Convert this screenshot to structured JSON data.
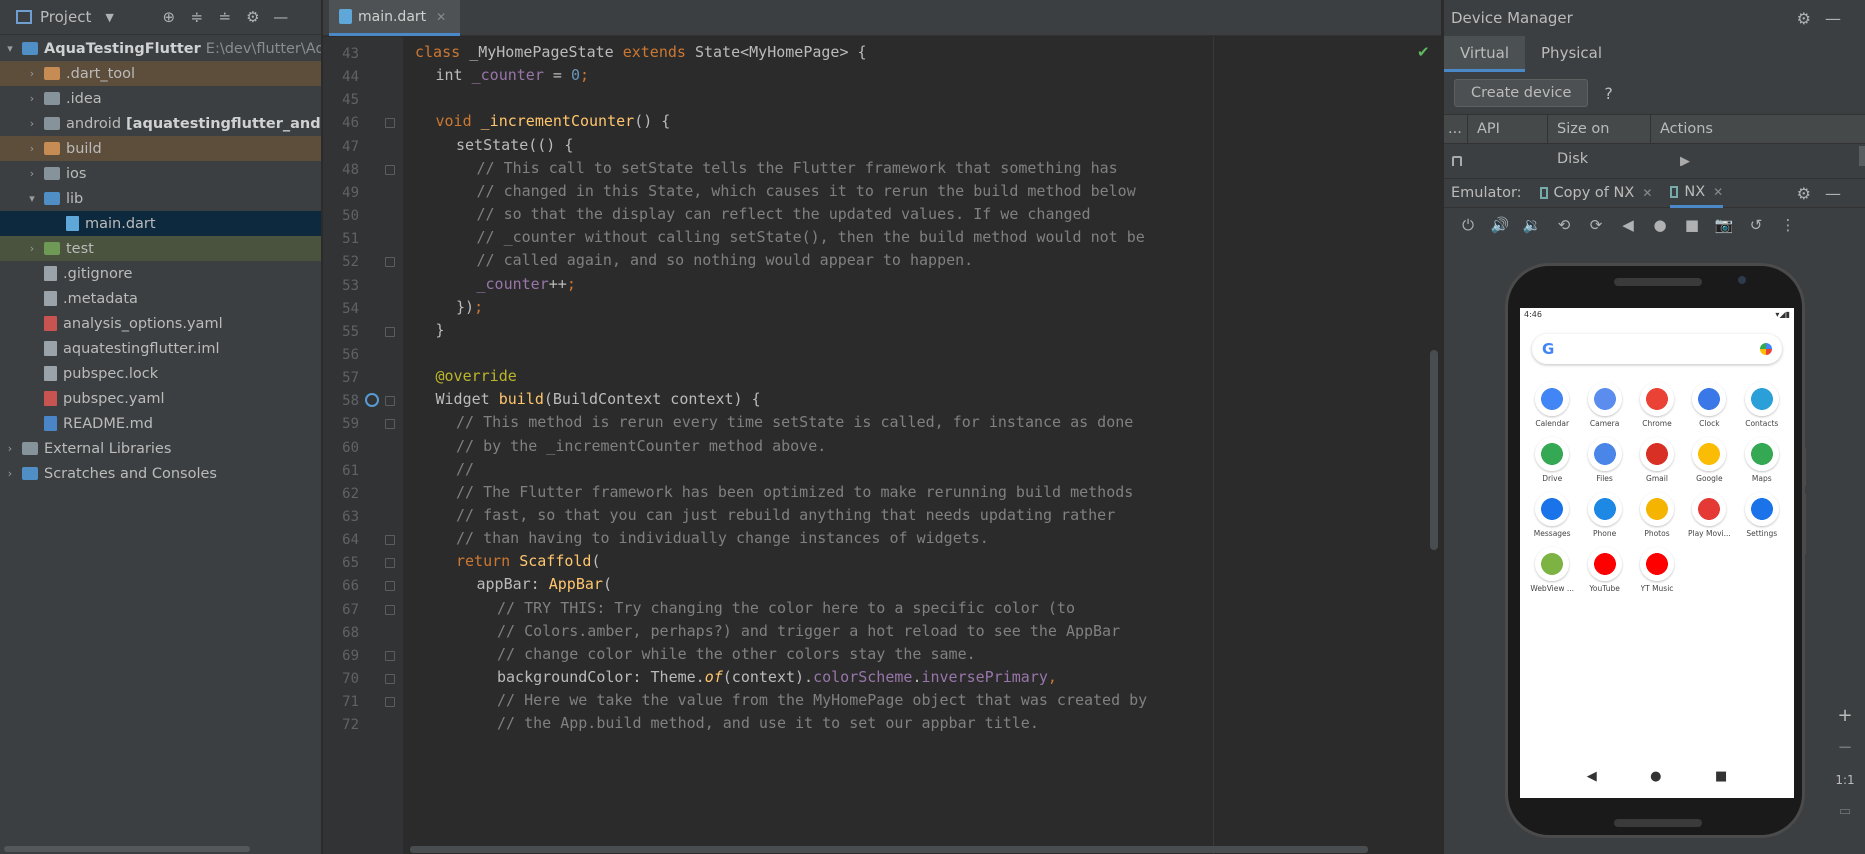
{
  "project": {
    "title": "Project",
    "tree": [
      {
        "label": "AquaTestingFlutter",
        "extra": "E:\\dev\\flutter\\Aqua",
        "indent": 0,
        "arrow": "▾",
        "icon": "flutter",
        "bold": true
      },
      {
        "label": ".dart_tool",
        "indent": 1,
        "arrow": "›",
        "icon": "folder-orange",
        "state": "excluded"
      },
      {
        "label": ".idea",
        "indent": 1,
        "arrow": "›",
        "icon": "folder"
      },
      {
        "label": "android",
        "extra": "[aquatestingflutter_android]",
        "indent": 1,
        "arrow": "›",
        "icon": "folder"
      },
      {
        "label": "build",
        "indent": 1,
        "arrow": "›",
        "icon": "folder-orange",
        "state": "excluded"
      },
      {
        "label": "ios",
        "indent": 1,
        "arrow": "›",
        "icon": "folder"
      },
      {
        "label": "lib",
        "indent": 1,
        "arrow": "▾",
        "icon": "folder-blue"
      },
      {
        "label": "main.dart",
        "indent": 2,
        "arrow": "",
        "icon": "dart",
        "state": "selected"
      },
      {
        "label": "test",
        "indent": 1,
        "arrow": "›",
        "icon": "folder-green",
        "state": "testsrc"
      },
      {
        "label": ".gitignore",
        "indent": 1,
        "arrow": "",
        "icon": "file"
      },
      {
        "label": ".metadata",
        "indent": 1,
        "arrow": "",
        "icon": "file"
      },
      {
        "label": "analysis_options.yaml",
        "indent": 1,
        "arrow": "",
        "icon": "yml"
      },
      {
        "label": "aquatestingflutter.iml",
        "indent": 1,
        "arrow": "",
        "icon": "file"
      },
      {
        "label": "pubspec.lock",
        "indent": 1,
        "arrow": "",
        "icon": "file"
      },
      {
        "label": "pubspec.yaml",
        "indent": 1,
        "arrow": "",
        "icon": "yml"
      },
      {
        "label": "README.md",
        "indent": 1,
        "arrow": "",
        "icon": "md"
      },
      {
        "label": "External Libraries",
        "indent": 0,
        "arrow": "›",
        "icon": "lib"
      },
      {
        "label": "Scratches and Consoles",
        "indent": 0,
        "arrow": "›",
        "icon": "scratch"
      }
    ]
  },
  "editor": {
    "tab": "main.dart",
    "lines": [
      {
        "n": "43",
        "indent": 0,
        "tokens": [
          [
            "kw",
            "class "
          ],
          [
            "",
            "_MyHomePageState "
          ],
          [
            "kw",
            "extends "
          ],
          [
            "",
            "State<MyHomePage> {"
          ]
        ]
      },
      {
        "n": "44",
        "indent": 1,
        "tokens": [
          [
            "",
            "int "
          ],
          [
            "fld",
            "_counter"
          ],
          [
            "",
            " = "
          ],
          [
            "num",
            "0"
          ],
          [
            "kw",
            ";"
          ]
        ]
      },
      {
        "n": "45",
        "indent": 0,
        "tokens": []
      },
      {
        "n": "46",
        "indent": 1,
        "tokens": [
          [
            "kw",
            "void "
          ],
          [
            "fn",
            "_incrementCounter"
          ],
          [
            "",
            "() {"
          ]
        ]
      },
      {
        "n": "47",
        "indent": 2,
        "tokens": [
          [
            "",
            "setState(() {"
          ]
        ]
      },
      {
        "n": "48",
        "indent": 3,
        "tokens": [
          [
            "cm",
            "// This call to setState tells the Flutter framework that something has"
          ]
        ]
      },
      {
        "n": "49",
        "indent": 3,
        "tokens": [
          [
            "cm",
            "// changed in this State, which causes it to rerun the build method below"
          ]
        ]
      },
      {
        "n": "50",
        "indent": 3,
        "tokens": [
          [
            "cm",
            "// so that the display can reflect the updated values. If we changed"
          ]
        ]
      },
      {
        "n": "51",
        "indent": 3,
        "tokens": [
          [
            "cm",
            "// _counter without calling setState(), then the build method would not be"
          ]
        ]
      },
      {
        "n": "52",
        "indent": 3,
        "tokens": [
          [
            "cm",
            "// called again, and so nothing would appear to happen."
          ]
        ]
      },
      {
        "n": "53",
        "indent": 3,
        "tokens": [
          [
            "fld",
            "_counter"
          ],
          [
            "",
            "++"
          ],
          [
            "kw",
            ";"
          ]
        ]
      },
      {
        "n": "54",
        "indent": 2,
        "tokens": [
          [
            "",
            "})"
          ],
          [
            "kw",
            ";"
          ]
        ]
      },
      {
        "n": "55",
        "indent": 1,
        "tokens": [
          [
            "",
            "}"
          ]
        ]
      },
      {
        "n": "56",
        "indent": 0,
        "tokens": []
      },
      {
        "n": "57",
        "indent": 1,
        "tokens": [
          [
            "ann",
            "@override"
          ]
        ]
      },
      {
        "n": "58",
        "indent": 1,
        "tokens": [
          [
            "",
            "Widget "
          ],
          [
            "fn",
            "build"
          ],
          [
            "",
            "(BuildContext context) {"
          ]
        ]
      },
      {
        "n": "59",
        "indent": 2,
        "tokens": [
          [
            "cm",
            "// This method is rerun every time setState is called, for instance as done"
          ]
        ]
      },
      {
        "n": "60",
        "indent": 2,
        "tokens": [
          [
            "cm",
            "// by the _incrementCounter method above."
          ]
        ]
      },
      {
        "n": "61",
        "indent": 2,
        "tokens": [
          [
            "cm",
            "//"
          ]
        ]
      },
      {
        "n": "62",
        "indent": 2,
        "tokens": [
          [
            "cm",
            "// The Flutter framework has been optimized to make rerunning build methods"
          ]
        ]
      },
      {
        "n": "63",
        "indent": 2,
        "tokens": [
          [
            "cm",
            "// fast, so that you can just rebuild anything that needs updating rather"
          ]
        ]
      },
      {
        "n": "64",
        "indent": 2,
        "tokens": [
          [
            "cm",
            "// than having to individually change instances of widgets."
          ]
        ]
      },
      {
        "n": "65",
        "indent": 2,
        "tokens": [
          [
            "kw",
            "return "
          ],
          [
            "fn",
            "Scaffold"
          ],
          [
            "",
            "("
          ]
        ]
      },
      {
        "n": "66",
        "indent": 3,
        "tokens": [
          [
            "",
            "appBar: "
          ],
          [
            "fn",
            "AppBar"
          ],
          [
            "",
            "("
          ]
        ]
      },
      {
        "n": "67",
        "indent": 4,
        "tokens": [
          [
            "cm",
            "// TRY THIS: Try changing the color here to a specific color (to"
          ]
        ]
      },
      {
        "n": "68",
        "indent": 4,
        "tokens": [
          [
            "cm",
            "// Colors.amber, perhaps?) and trigger a hot reload to see the AppBar"
          ]
        ]
      },
      {
        "n": "69",
        "indent": 4,
        "tokens": [
          [
            "cm",
            "// change color while the other colors stay the same."
          ]
        ]
      },
      {
        "n": "70",
        "indent": 4,
        "tokens": [
          [
            "",
            "backgroundColor: Theme."
          ],
          [
            "fn it",
            "of"
          ],
          [
            "",
            "(context)."
          ],
          [
            "fld",
            "colorScheme"
          ],
          [
            "",
            "."
          ],
          [
            "fld",
            "inversePrimary"
          ],
          [
            "kw",
            ","
          ]
        ]
      },
      {
        "n": "71",
        "indent": 4,
        "tokens": [
          [
            "cm",
            "// Here we take the value from the MyHomePage object that was created by"
          ]
        ]
      },
      {
        "n": "72",
        "indent": 4,
        "tokens": [
          [
            "cm",
            "// the App.build method, and use it to set our appbar title."
          ]
        ]
      }
    ]
  },
  "device_manager": {
    "title": "Device Manager",
    "tabs": [
      "Virtual",
      "Physical"
    ],
    "create_device": "Create device",
    "help": "?",
    "columns": [
      "...",
      "API",
      "Size on Disk",
      "Actions"
    ],
    "emulator_label": "Emulator:",
    "emulator_tabs": [
      "Copy of NX",
      "NX"
    ],
    "zoom_label": "1:1"
  },
  "phone": {
    "time": "4:46",
    "apps": [
      {
        "label": "Calendar",
        "color": "#4285f4"
      },
      {
        "label": "Camera",
        "color": "#5b8def"
      },
      {
        "label": "Chrome",
        "color": "#ea4335"
      },
      {
        "label": "Clock",
        "color": "#3b78e7"
      },
      {
        "label": "Contacts",
        "color": "#2a9fd8"
      },
      {
        "label": "Drive",
        "color": "#34a853"
      },
      {
        "label": "Files",
        "color": "#4a86e8"
      },
      {
        "label": "Gmail",
        "color": "#d93025"
      },
      {
        "label": "Google",
        "color": "#fbbc05"
      },
      {
        "label": "Maps",
        "color": "#34a853"
      },
      {
        "label": "Messages",
        "color": "#1a73e8"
      },
      {
        "label": "Phone",
        "color": "#1e88e5"
      },
      {
        "label": "Photos",
        "color": "#f4b400"
      },
      {
        "label": "Play Movi...",
        "color": "#e53935"
      },
      {
        "label": "Settings",
        "color": "#1a73e8"
      },
      {
        "label": "WebView ...",
        "color": "#7cb342"
      },
      {
        "label": "YouTube",
        "color": "#ff0000"
      },
      {
        "label": "YT Music",
        "color": "#ff0000"
      }
    ]
  }
}
